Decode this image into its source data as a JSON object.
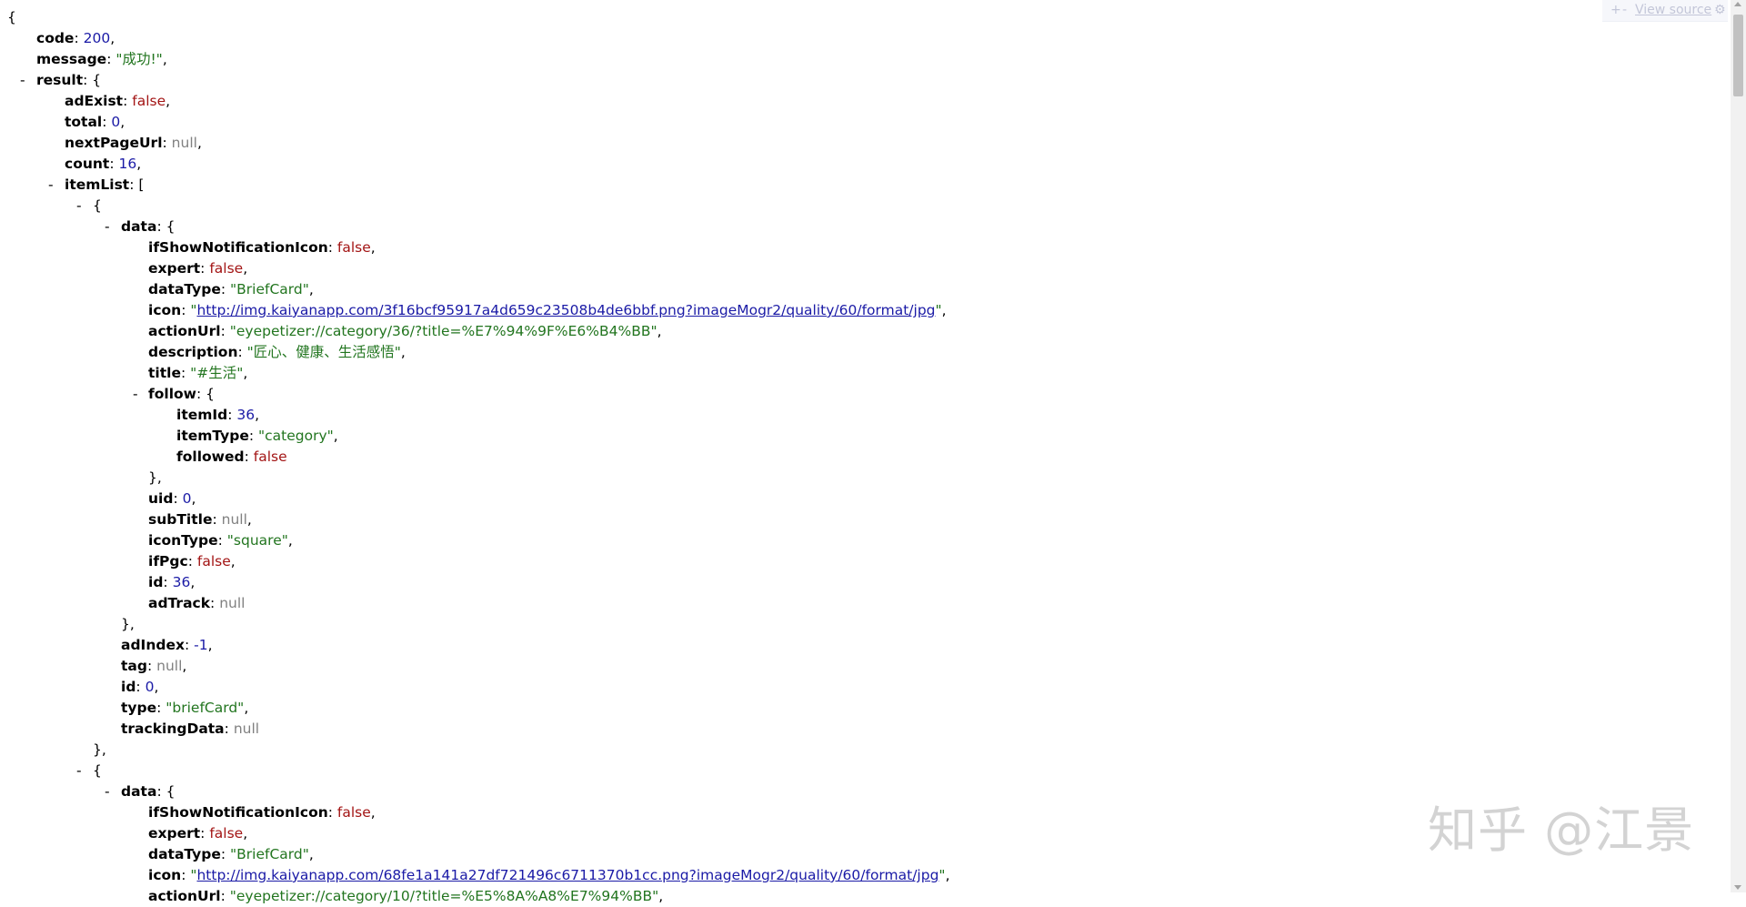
{
  "toolbar": {
    "expand": "+",
    "collapse": "-",
    "view_source": "View source",
    "gear": "⚙"
  },
  "root_open": "{",
  "code": {
    "key": "code",
    "value": "200"
  },
  "message": {
    "key": "message",
    "value": "\"成功!\""
  },
  "result": {
    "key": "result",
    "adExist": {
      "key": "adExist",
      "value": "false"
    },
    "total": {
      "key": "total",
      "value": "0"
    },
    "nextPageUrl": {
      "key": "nextPageUrl",
      "value": "null"
    },
    "count": {
      "key": "count",
      "value": "16"
    },
    "itemList_key": "itemList"
  },
  "items": [
    {
      "data": {
        "ifShowNotificationIcon": "false",
        "expert": "false",
        "dataType": "\"BriefCard\"",
        "icon": "http://img.kaiyanapp.com/3f16bcf95917a4d659c23508b4de6bbf.png?imageMogr2/quality/60/format/jpg",
        "actionUrl": "\"eyepetizer://category/36/?title=%E7%94%9F%E6%B4%BB\"",
        "description": "\"匠心、健康、生活感悟\"",
        "title": "\"#生活\"",
        "follow": {
          "itemId": "36",
          "itemType": "\"category\"",
          "followed": "false"
        },
        "uid": "0",
        "subTitle": "null",
        "iconType": "\"square\"",
        "ifPgc": "false",
        "id": "36",
        "adTrack": "null"
      },
      "adIndex": "-1",
      "tag": "null",
      "id": "0",
      "type": "\"briefCard\"",
      "trackingData": "null"
    },
    {
      "data": {
        "ifShowNotificationIcon": "false",
        "expert": "false",
        "dataType": "\"BriefCard\"",
        "icon": "http://img.kaiyanapp.com/68fe1a141a27df721496c6711370b1cc.png?imageMogr2/quality/60/format/jpg",
        "actionUrl": "\"eyepetizer://category/10/?title=%E5%8A%A8%E7%94%BB\""
      }
    }
  ],
  "watermark": "知乎 @江景"
}
